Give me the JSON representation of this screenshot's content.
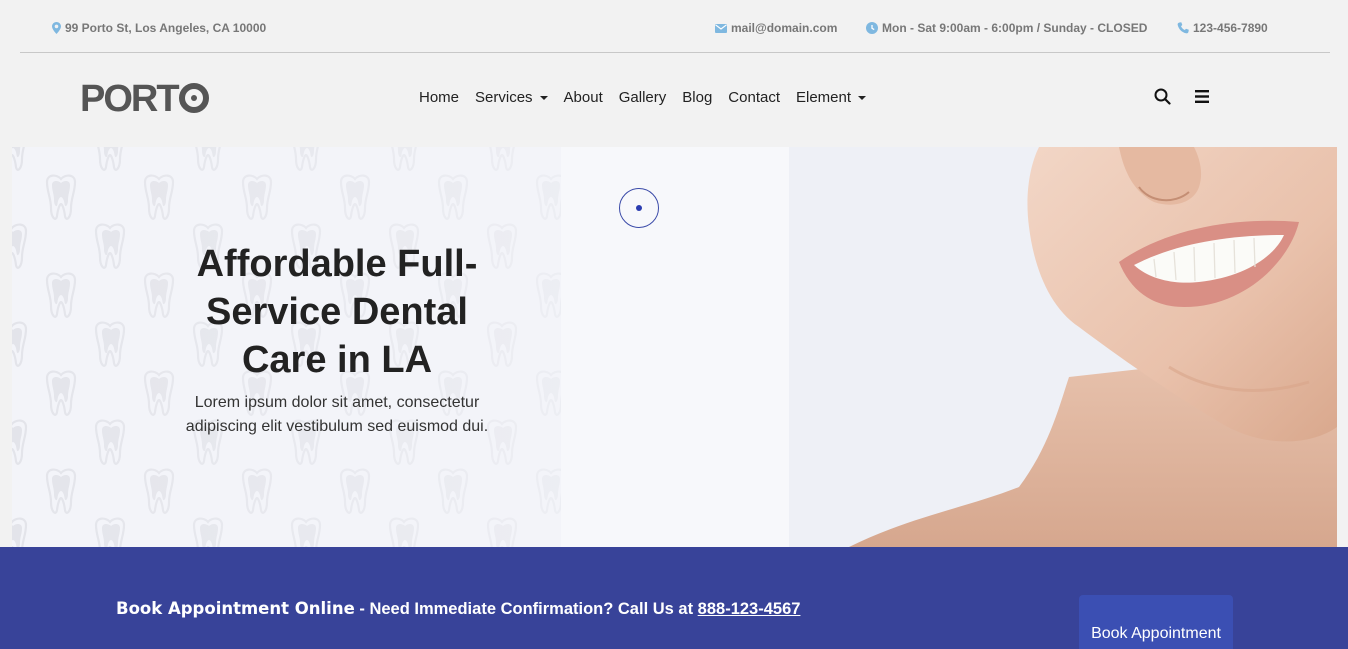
{
  "topbar": {
    "address": "99 Porto St, Los Angeles, CA 10000",
    "email": "mail@domain.com",
    "hours": "Mon - Sat 9:00am - 6:00pm / Sunday - CLOSED",
    "phone": "123-456-7890",
    "icon_color": "#7fb8e0"
  },
  "header": {
    "logo_text_a": "PORT",
    "nav": {
      "home": "Home",
      "services": "Services",
      "about": "About",
      "gallery": "Gallery",
      "blog": "Blog",
      "contact": "Contact",
      "element": "Element"
    },
    "icons": [
      "search-icon",
      "menu-icon"
    ]
  },
  "hero": {
    "title": "Affordable Full-Service Dental Care in LA",
    "text": "Lorem ipsum dolor sit amet, consectetur adipiscing elit vestibulum sed euismod dui."
  },
  "band": {
    "lead": "Book Appointment Online",
    "rest": " - Need Immediate Confirmation? Call Us at ",
    "phone": "888-123-4567",
    "button": "Book Appointment",
    "color": "#384399"
  }
}
